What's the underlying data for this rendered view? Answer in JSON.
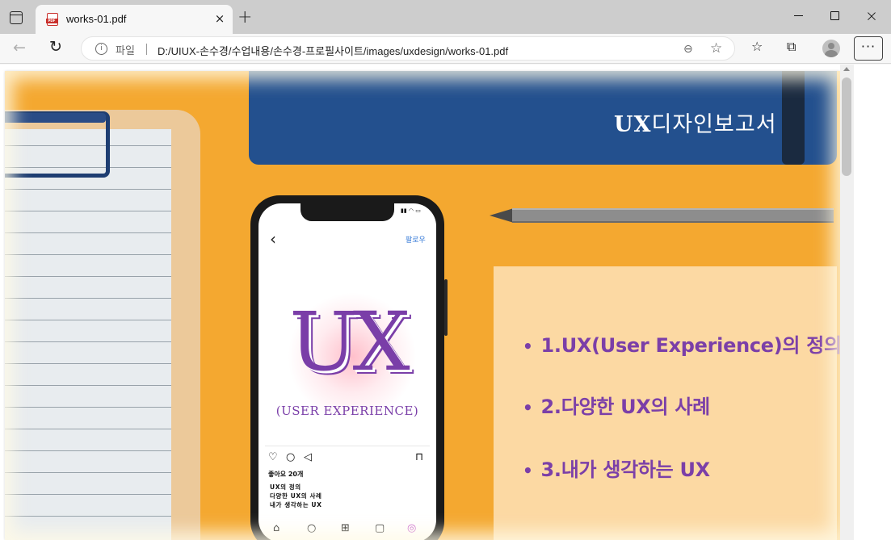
{
  "browser": {
    "tab": {
      "title": "works-01.pdf",
      "favicon_label": "PDF"
    },
    "nav": {
      "scheme_label": "파일",
      "url": "D:/UIUX-손수경/수업내용/손수경-프로필사이트/images/uxdesign/works-01.pdf"
    },
    "icons": {
      "tab_actions": "tab-actions-icon",
      "close": "×",
      "new_tab": "+",
      "back": "←",
      "reload": "↻",
      "info": "i",
      "zoom": "⊖",
      "favorites_add": "☆",
      "favorites": "☆",
      "collections": "⧉",
      "more": "···"
    }
  },
  "pdf": {
    "notebook_title_mark": "UX",
    "notebook_title": "디자인보고서",
    "agenda": [
      {
        "bullet": "•",
        "label": "1.UX(User Experience)의 정의"
      },
      {
        "bullet": "•",
        "label": "2.다양한 UX의 사례"
      },
      {
        "bullet": "•",
        "label": "3.내가 생각하는 UX"
      }
    ],
    "phone": {
      "follow": "팔로우",
      "post_title": "UX",
      "post_subtitle": "(USER EXPERIENCE)",
      "likes": "좋아요 20개",
      "caption": [
        "UX의 정의",
        "다양한 UX의 사례",
        "내가 생각하는 UX"
      ]
    }
  },
  "colors": {
    "background_orange": "#f4a830",
    "notebook_blue": "#23508e",
    "accent_purple": "#7b3fa8",
    "notecard": "#fcd9a3"
  }
}
